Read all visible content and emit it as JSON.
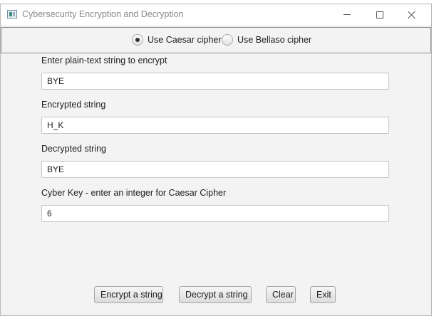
{
  "window": {
    "title": "Cybersecurity Encryption and Decryption"
  },
  "cipher_options": [
    {
      "label": "Use Caesar cipher",
      "selected": true
    },
    {
      "label": "Use Bellaso cipher",
      "selected": false
    }
  ],
  "fields": {
    "plain_text": {
      "label": "Enter plain-text string to encrypt",
      "value": "BYE"
    },
    "encrypted": {
      "label": "Encrypted string",
      "value": "H_K"
    },
    "decrypted": {
      "label": "Decrypted string",
      "value": "BYE"
    },
    "key": {
      "label": "Cyber Key - enter an integer for Caesar Cipher",
      "value": "6"
    }
  },
  "buttons": {
    "encrypt": "Encrypt a string",
    "decrypt": "Decrypt a string",
    "clear": "Clear",
    "exit": "Exit"
  }
}
